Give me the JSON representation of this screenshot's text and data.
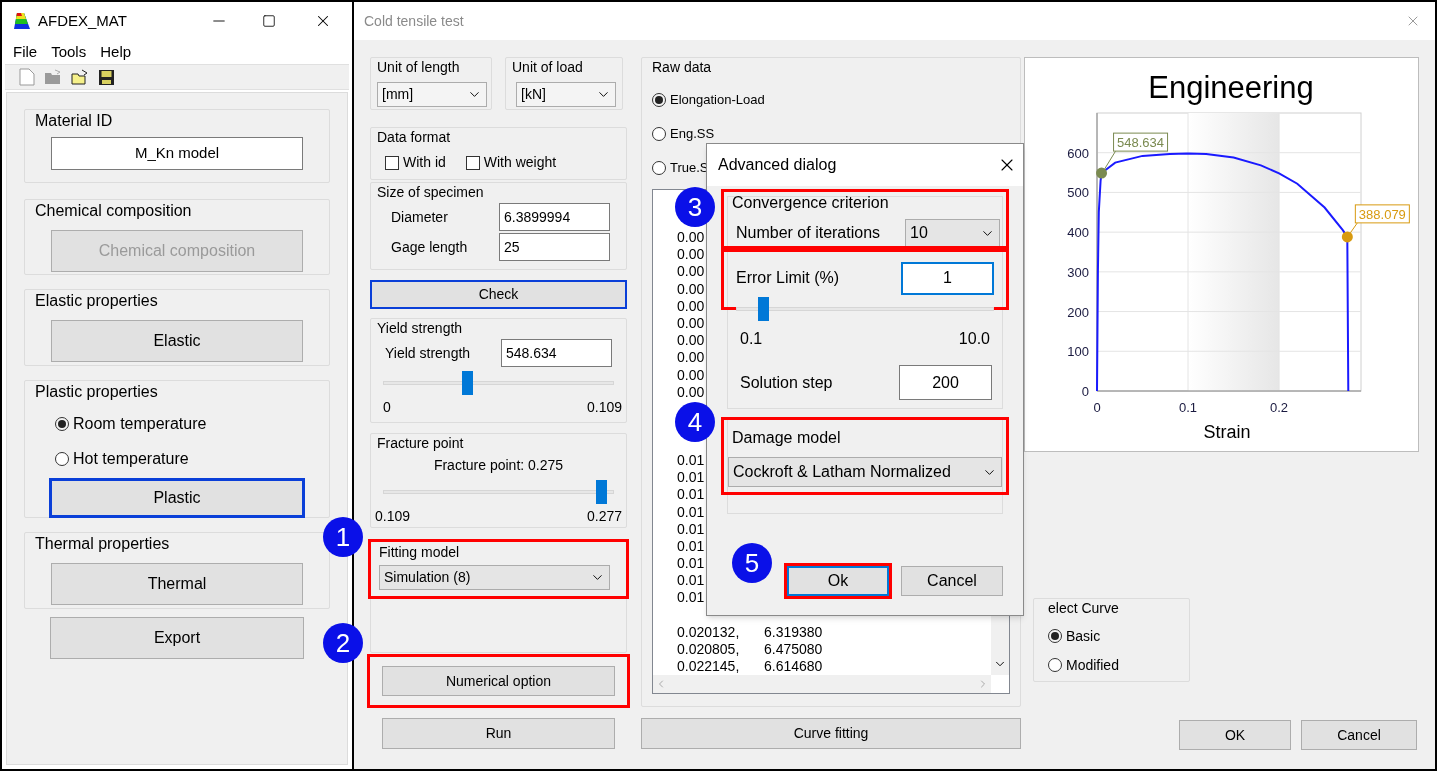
{
  "app_window": {
    "title": "AFDEX_MAT",
    "menu": [
      "File",
      "Tools",
      "Help"
    ],
    "sections": [
      {
        "kind": "field",
        "title": "Material ID",
        "value": "M_Kn model"
      },
      {
        "kind": "button",
        "title": "Chemical composition",
        "button": "Chemical composition",
        "disabled": true,
        "focused": false
      },
      {
        "kind": "button",
        "title": "Elastic properties",
        "button": "Elastic",
        "disabled": false,
        "focused": false
      },
      {
        "kind": "radios",
        "title": "Plastic properties",
        "options": [
          {
            "label": "Room temperature",
            "selected": true
          },
          {
            "label": "Hot temperature",
            "selected": false
          }
        ],
        "button": "Plastic",
        "disabled": false,
        "focused": true
      },
      {
        "kind": "button",
        "title": "Thermal properties",
        "button": "Thermal",
        "disabled": false,
        "focused": false
      }
    ],
    "export_button": "Export"
  },
  "test_window": {
    "title": "Cold tensile test",
    "unit_of_length": {
      "label": "Unit of length",
      "value": "[mm]"
    },
    "unit_of_load": {
      "label": "Unit of load",
      "value": "[kN]"
    },
    "data_format": {
      "label": "Data format",
      "options": [
        {
          "label": "With id",
          "checked": false
        },
        {
          "label": "With weight",
          "checked": false
        }
      ]
    },
    "specimen": {
      "label": "Size of specimen",
      "fields": [
        {
          "label": "Diameter",
          "value": "6.3899994"
        },
        {
          "label": "Gage length",
          "value": "25"
        }
      ]
    },
    "check_button": {
      "label": "Check",
      "focused": true
    },
    "yield_strength": {
      "label": "Yield strength",
      "field_label": "Yield strength",
      "value": "548.634",
      "level": 0.36,
      "min": "0",
      "max": "0.109"
    },
    "fracture_point": {
      "label": "Fracture point",
      "reading": "Fracture point: 0.275",
      "level": 0.97,
      "min": "0.109",
      "max": "0.277"
    },
    "fitting_model": {
      "label": "Fitting model",
      "value": "Simulation (8)",
      "highlighted": true
    },
    "numerical_option": {
      "label": "Numerical option",
      "highlighted": true
    },
    "run_button": "Run",
    "raw_data": {
      "label": "Raw data",
      "options": [
        {
          "label": "Elongation-Load",
          "selected": true
        },
        {
          "label": "Eng.SS",
          "selected": false
        },
        {
          "label": "True.S",
          "selected": false
        }
      ],
      "rows_top": [
        {
          "col1": "0.00"
        },
        {
          "col1": "0.00"
        },
        {
          "col1": "0.00"
        },
        {
          "col1": "0.00"
        },
        {
          "col1": "0.00"
        },
        {
          "col1": "0.00"
        },
        {
          "col1": "0.00"
        },
        {
          "col1": "0.00"
        },
        {
          "col1": "0.00"
        },
        {
          "col1": "0.00"
        }
      ],
      "rows_middle": [
        {
          "col1": "0.01"
        },
        {
          "col1": "0.01"
        },
        {
          "col1": "0.01"
        },
        {
          "col1": "0.01"
        },
        {
          "col1": "0.01"
        },
        {
          "col1": "0.01"
        },
        {
          "col1": "0.01"
        },
        {
          "col1": "0.01"
        },
        {
          "col1": "0.01"
        }
      ],
      "rows_bottom": [
        {
          "col1": "0.020132,",
          "col2": "6.319380"
        },
        {
          "col1": "0.020805,",
          "col2": "6.475080"
        },
        {
          "col1": "0.022145,",
          "col2": "6.614680"
        }
      ]
    },
    "curve_fitting_button": "Curve fitting",
    "chart": {
      "chart_data": {
        "type": "line",
        "title": "Engineering",
        "xlabel": "Strain",
        "x": [
          0,
          0.001,
          0.002,
          0.004,
          0.005,
          0.02,
          0.05,
          0.08,
          0.1,
          0.12,
          0.15,
          0.18,
          0.2,
          0.22,
          0.25,
          0.27,
          0.275,
          0.276
        ],
        "values": [
          0,
          300,
          450,
          530,
          549,
          575,
          592,
          597,
          598,
          597,
          588,
          568,
          548,
          522,
          462,
          405,
          388,
          0
        ],
        "xlim": [
          0,
          0.29
        ],
        "ylim": [
          0,
          700
        ],
        "xticks": [
          0,
          0.1,
          0.2
        ],
        "yticks": [
          0,
          100,
          200,
          300,
          400,
          500,
          600
        ],
        "grid": true,
        "annotations": [
          {
            "x": 0.005,
            "y": 548.634,
            "text": "548.634"
          },
          {
            "x": 0.275,
            "y": 388.079,
            "text": "388.079"
          }
        ]
      }
    },
    "select_curve": {
      "label": "elect Curve",
      "options": [
        {
          "label": "Basic",
          "selected": true
        },
        {
          "label": "Modified",
          "selected": false
        }
      ]
    },
    "buttons": [
      "OK",
      "Cancel"
    ]
  },
  "advanced_dialog": {
    "title": "Advanced dialog",
    "convergence": {
      "label": "Convergence criterion",
      "highlighted": true,
      "iterations": {
        "label": "Number of iterations",
        "value": "10"
      },
      "error_limit": {
        "label": "Error Limit (%)",
        "value": "1",
        "highlighted": true,
        "focused": true,
        "level": 0.09,
        "min": "0.1",
        "max": "10.0"
      },
      "solution_step": {
        "label": "Solution step",
        "value": "200"
      }
    },
    "damage_model": {
      "label": "Damage model",
      "value": "Cockroft & Latham Normalized",
      "highlighted": true
    },
    "buttons": [
      {
        "label": "Ok",
        "highlighted": true,
        "focused": true
      },
      {
        "label": "Cancel",
        "highlighted": false,
        "focused": false
      }
    ]
  },
  "callouts": [
    "1",
    "2",
    "3",
    "4",
    "5"
  ]
}
